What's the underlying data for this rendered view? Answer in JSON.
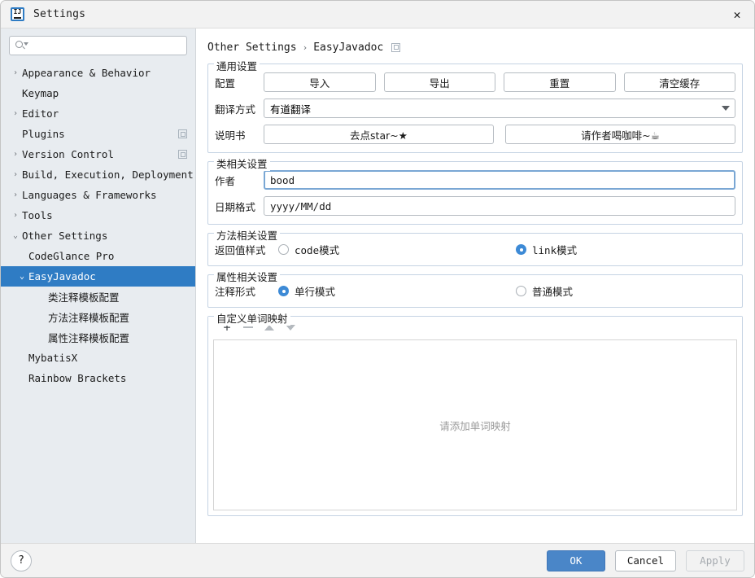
{
  "window": {
    "title": "Settings",
    "logo_icon": "intellij-idea-logo",
    "close_icon": "close-icon"
  },
  "sidebar": {
    "search": {
      "value": "",
      "placeholder": "",
      "icon": "search-icon"
    },
    "items": [
      {
        "label": "Appearance & Behavior",
        "twisty": "›",
        "indent": 0,
        "selected": false,
        "badge": false
      },
      {
        "label": "Keymap",
        "twisty": "",
        "indent": 0,
        "selected": false,
        "badge": false
      },
      {
        "label": "Editor",
        "twisty": "›",
        "indent": 0,
        "selected": false,
        "badge": false
      },
      {
        "label": "Plugins",
        "twisty": "",
        "indent": 0,
        "selected": false,
        "badge": true
      },
      {
        "label": "Version Control",
        "twisty": "›",
        "indent": 0,
        "selected": false,
        "badge": true
      },
      {
        "label": "Build, Execution, Deployment",
        "twisty": "›",
        "indent": 0,
        "selected": false,
        "badge": false
      },
      {
        "label": "Languages & Frameworks",
        "twisty": "›",
        "indent": 0,
        "selected": false,
        "badge": false
      },
      {
        "label": "Tools",
        "twisty": "›",
        "indent": 0,
        "selected": false,
        "badge": false
      },
      {
        "label": "Other Settings",
        "twisty": "⌄",
        "indent": 0,
        "selected": false,
        "badge": false
      },
      {
        "label": "CodeGlance Pro",
        "twisty": "",
        "indent": 1,
        "selected": false,
        "badge": false
      },
      {
        "label": "EasyJavadoc",
        "twisty": "⌄",
        "indent": 1,
        "selected": true,
        "badge": false
      },
      {
        "label": "类注释模板配置",
        "twisty": "",
        "indent": 2,
        "selected": false,
        "badge": false
      },
      {
        "label": "方法注释模板配置",
        "twisty": "",
        "indent": 2,
        "selected": false,
        "badge": false
      },
      {
        "label": "属性注释模板配置",
        "twisty": "",
        "indent": 2,
        "selected": false,
        "badge": false
      },
      {
        "label": "MybatisX",
        "twisty": "",
        "indent": 1,
        "selected": false,
        "badge": false
      },
      {
        "label": "Rainbow Brackets",
        "twisty": "",
        "indent": 1,
        "selected": false,
        "badge": false
      }
    ]
  },
  "main": {
    "breadcrumb": {
      "parent": "Other Settings",
      "separator": "›",
      "current": "EasyJavadoc",
      "badge_icon": "external-window-icon"
    },
    "general": {
      "title": "通用设置",
      "config_label": "配置",
      "config_buttons": [
        "导入",
        "导出",
        "重置",
        "清空缓存"
      ],
      "translate_label": "翻译方式",
      "translate_value": "有道翻译",
      "manual_label": "说明书",
      "manual_buttons": [
        "去点star~★",
        "请作者喝咖啡~☕"
      ]
    },
    "class_settings": {
      "title": "类相关设置",
      "author_label": "作者",
      "author_value": "bood",
      "date_label": "日期格式",
      "date_value": "yyyy/MM/dd"
    },
    "method_settings": {
      "title": "方法相关设置",
      "label": "返回值样式",
      "options": [
        {
          "label": "code模式",
          "checked": false
        },
        {
          "label": "link模式",
          "checked": true
        }
      ]
    },
    "field_settings": {
      "title": "属性相关设置",
      "label": "注释形式",
      "options": [
        {
          "label": "单行模式",
          "checked": true
        },
        {
          "label": "普通模式",
          "checked": false
        }
      ]
    },
    "word_mapping": {
      "title": "自定义单词映射",
      "toolbar": {
        "add_icon": "plus-icon",
        "remove_icon": "minus-icon",
        "up_icon": "arrow-up-icon",
        "down_icon": "arrow-down-icon",
        "add_label": "+"
      },
      "empty_text": "请添加单词映射"
    }
  },
  "footer": {
    "help_label": "?",
    "ok_label": "OK",
    "cancel_label": "Cancel",
    "apply_label": "Apply"
  },
  "colors": {
    "accent": "#2f7cc4",
    "primary_button": "#4a86c8",
    "radio_checked": "#3d8ad6",
    "sidebar_bg": "#e8ecf0"
  }
}
